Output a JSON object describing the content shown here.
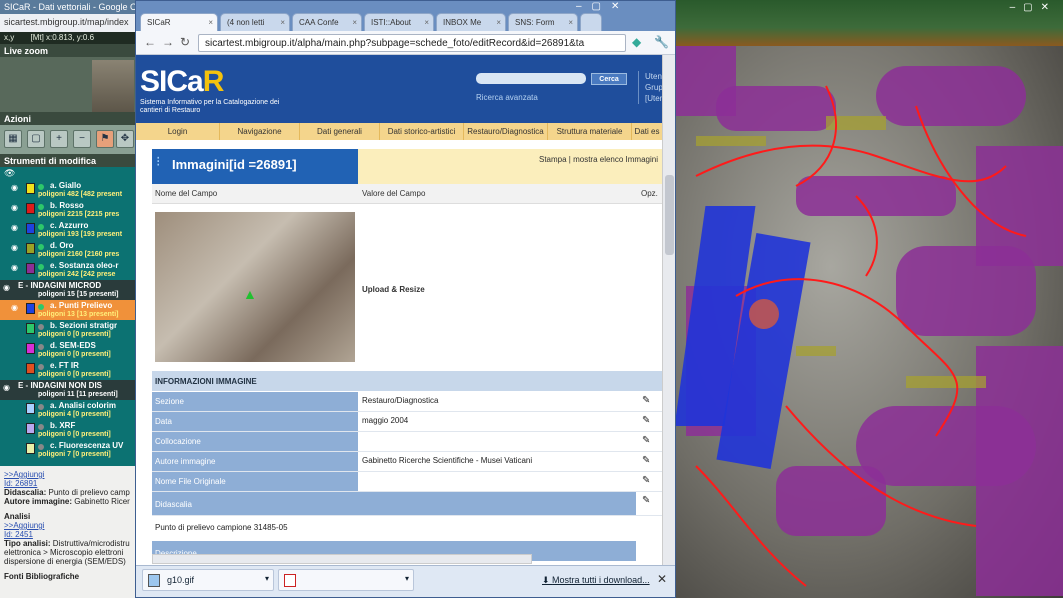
{
  "left_app": {
    "title": "SICaR - Dati vettoriali - Google C",
    "url": "sicartest.mbigroup.it/map/index",
    "coords_label": "x,y",
    "coords_value": "[Mt] x:0.813, y:0.6",
    "live_zoom": "Live zoom",
    "azioni": "Azioni",
    "strumenti": "Strumenti di modifica",
    "layers": [
      {
        "name": "a. Giallo",
        "count": "poligoni 482 [482 present",
        "color": "#f2e11c"
      },
      {
        "name": "b. Rosso",
        "count": "poligoni 2215 [2215 pres",
        "color": "#e01b1b"
      },
      {
        "name": "c. Azzurro",
        "count": "poligoni 193 [193 present",
        "color": "#1f43e0"
      },
      {
        "name": "d. Oro",
        "count": "poligoni 2160 [2160 pres",
        "color": "#9aa226"
      },
      {
        "name": "e. Sostanza oleo-r",
        "count": "poligoni 242 [242 prese",
        "color": "#8c2f96"
      },
      {
        "name": "E - INDAGINI MICROD",
        "count": "poligoni 15 [15 presenti]"
      },
      {
        "name": "a. Punti Prelievo",
        "count": "poligoni 13 [13 presenti]",
        "color": "#1f43e0"
      },
      {
        "name": "b. Sezioni stratigr",
        "count": "poligoni 0 [0 presenti]",
        "color": "#2dc86a"
      },
      {
        "name": "d. SEM-EDS",
        "count": "poligoni 0 [0 presenti]",
        "color": "#d62fd6"
      },
      {
        "name": "e. FT IR",
        "count": "poligoni 0 [0 presenti]",
        "color": "#e05020"
      },
      {
        "name": "E - INDAGINI NON DIS",
        "count": "poligoni 11 [11 presenti]"
      },
      {
        "name": "a. Analisi colorim",
        "count": "poligoni 4 [0 presenti]",
        "color": "#a9d0ff"
      },
      {
        "name": "b. XRF",
        "count": "poligoni 0 [0 presenti]",
        "color": "#b8a8ee"
      },
      {
        "name": "c. Fluorescenza UV",
        "count": "poligoni 7 [0 presenti]",
        "color": "#e8f0a8"
      }
    ],
    "bottom": {
      "aggiungi_1": ">>Aggiungi",
      "id_1": "Id: 26891",
      "didascalia_label": "Didascalia:",
      "didascalia_value": "Punto di prelievo camp",
      "autore_label": "Autore immagine:",
      "autore_value": "Gabinetto Ricer",
      "analisi": "Analisi",
      "aggiungi_2": ">>Aggiungi",
      "id_2": "Id: 2451",
      "tipo_label": "Tipo analisi:",
      "tipo_value": "Distruttiva/microdistru",
      "line2": "elettronica > Microscopio elettroni",
      "line3": "dispersione di energia (SEM/EDS)",
      "fonti": "Fonti Bibliografiche"
    }
  },
  "browser": {
    "tabs": [
      "SICaR",
      "(4 non letti",
      "CAA Confe",
      "ISTI::About",
      "INBOX Me",
      "SNS: Form"
    ],
    "url": "sicartest.mbigroup.it/alpha/main.php?subpage=schede_foto/editRecord&id=26891&ta",
    "downloads": {
      "file1": "g10.gif",
      "show_all": "Mostra tutti i download..."
    }
  },
  "sicar": {
    "logo_main": "SICa",
    "logo_accent": "R",
    "logo_sub": "Sistema Informativo per la Catalogazione dei cantieri di Restauro",
    "search_button": "Cerca",
    "advanced_search": "Ricerca avanzata",
    "user_line1": "Uten",
    "user_line2": "Grup",
    "user_line3": "[Uten",
    "menu": [
      "Login",
      "Navigazione",
      "Dati generali",
      "Dati storico-artistici",
      "Restauro/Diagnostica",
      "Struttura materiale",
      "Dati es"
    ],
    "record_title": "Immagini[id =26891]",
    "print_links": "Stampa | mostra elenco Immagini",
    "col_field": "Nome del Campo",
    "col_value": "Valore del Campo",
    "col_opt": "Opz.",
    "upload": "Upload & Resize",
    "info_heading": "INFORMAZIONI IMMAGINE",
    "rows": [
      {
        "label": "Sezione",
        "value": "Restauro/Diagnostica"
      },
      {
        "label": "Data",
        "value": "maggio 2004"
      },
      {
        "label": "Collocazione",
        "value": ""
      },
      {
        "label": "Autore immagine",
        "value": "Gabinetto Ricerche Scientifiche - Musei Vaticani"
      },
      {
        "label": "Nome File Originale",
        "value": ""
      },
      {
        "label": "Didascalia",
        "value": ""
      }
    ],
    "didascalia_text": "Punto di prelievo campione 31485-05",
    "descrizione": "Descrizione"
  }
}
